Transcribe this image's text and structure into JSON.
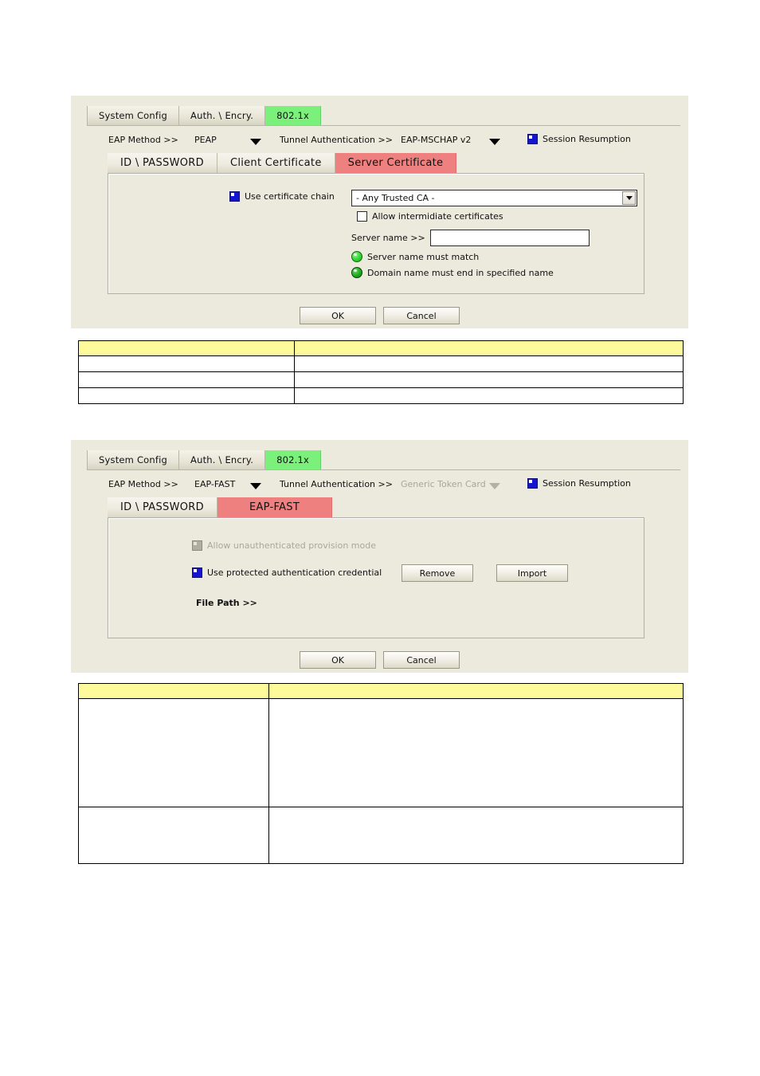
{
  "dialog1": {
    "name": "802.1x Server Certificate dialog",
    "top_tabs": [
      {
        "label": "System Config",
        "active": false
      },
      {
        "label": "Auth. \\ Encry.",
        "active": false
      },
      {
        "label": "802.1x",
        "active": true
      }
    ],
    "eap_method_label": "EAP Method >>",
    "eap_method_value": "PEAP",
    "tunnel_label": "Tunnel Authentication >>",
    "tunnel_value": "EAP-MSCHAP v2",
    "session_resumption_label": "Session Resumption",
    "session_resumption_checked": true,
    "inner_tabs": [
      {
        "label": "ID \\ PASSWORD",
        "active": false
      },
      {
        "label": "Client Certificate",
        "active": false
      },
      {
        "label": "Server Certificate",
        "active": true
      }
    ],
    "use_certificate_chain_label": "Use certificate chain",
    "use_certificate_chain_checked": true,
    "ca_combo_value": "- Any Trusted CA -",
    "allow_intermediate_label": "Allow intermidiate certificates",
    "allow_intermediate_checked": false,
    "server_name_label": "Server name >>",
    "server_name_value": "",
    "server_name_placeholder": "",
    "bullet_server_match": "Server name must match",
    "bullet_domain_end": "Domain name must end in specified name",
    "ok_label": "OK",
    "cancel_label": "Cancel"
  },
  "dialog2": {
    "name": "802.1x EAP-FAST dialog",
    "top_tabs": [
      {
        "label": "System Config",
        "active": false
      },
      {
        "label": "Auth. \\ Encry.",
        "active": false
      },
      {
        "label": "802.1x",
        "active": true
      }
    ],
    "eap_method_label": "EAP Method >>",
    "eap_method_value": "EAP-FAST",
    "tunnel_label": "Tunnel Authentication >>",
    "tunnel_value": "Generic Token Card",
    "session_resumption_label": "Session Resumption",
    "session_resumption_checked": true,
    "inner_tabs": [
      {
        "label": "ID \\ PASSWORD",
        "active": false
      },
      {
        "label": "EAP-FAST",
        "active": true
      }
    ],
    "allow_unauth_label": "Allow unauthenticated provision mode",
    "allow_unauth_checked": true,
    "allow_unauth_disabled": true,
    "use_pac_label": "Use protected authentication credential",
    "use_pac_checked": true,
    "remove_label": "Remove",
    "import_label": "Import",
    "file_path_label": "File Path >>",
    "ok_label": "OK",
    "cancel_label": "Cancel"
  },
  "table1": {
    "header": [
      "",
      ""
    ],
    "rows": [
      [
        "",
        ""
      ],
      [
        "",
        ""
      ],
      [
        "",
        ""
      ]
    ]
  },
  "table2": {
    "header": [
      "",
      ""
    ],
    "rows": [
      [
        "",
        ""
      ],
      [
        "",
        ""
      ]
    ]
  },
  "colors": {
    "dialog_bg": "#ece9dd",
    "active_top_tab": "#7bf07b",
    "active_inner_tab": "#ef8080",
    "table_header": "#fdfa9b",
    "checkbox_checked": "#1414d2",
    "page_bg": "#ffffff"
  }
}
